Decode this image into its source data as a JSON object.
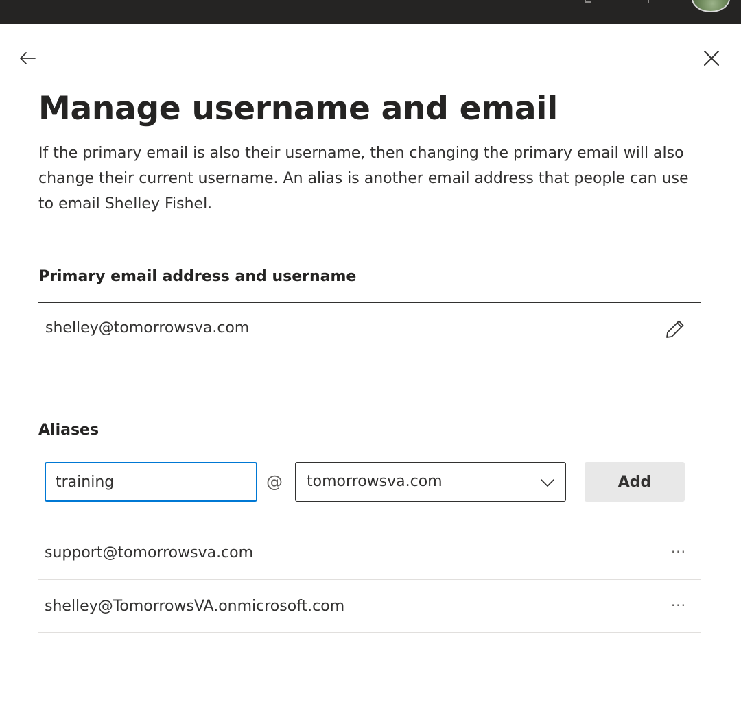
{
  "header": {
    "title": "Manage username and email",
    "description": "If the primary email is also their username, then changing the primary email will also change their current username. An alias is another email address that people can use to email Shelley Fishel."
  },
  "primary": {
    "label": "Primary email address and username",
    "value": "shelley@tomorrowsva.com"
  },
  "aliases": {
    "label": "Aliases",
    "input_value": "training",
    "at": "@",
    "domain_value": "tomorrowsva.com",
    "add_label": "Add",
    "items": [
      {
        "address": "support@tomorrowsva.com",
        "more": "···"
      },
      {
        "address": "shelley@TomorrowsVA.onmicrosoft.com",
        "more": "···"
      }
    ]
  },
  "icons": {
    "back": "arrow-left-icon",
    "close": "close-icon",
    "edit": "pencil-icon",
    "dropdown": "chevron-down-icon",
    "more": "more-icon"
  },
  "colors": {
    "accent": "#0078d4",
    "topbar": "#252423",
    "text": "#323130",
    "button_bg": "#e8e8e8"
  }
}
